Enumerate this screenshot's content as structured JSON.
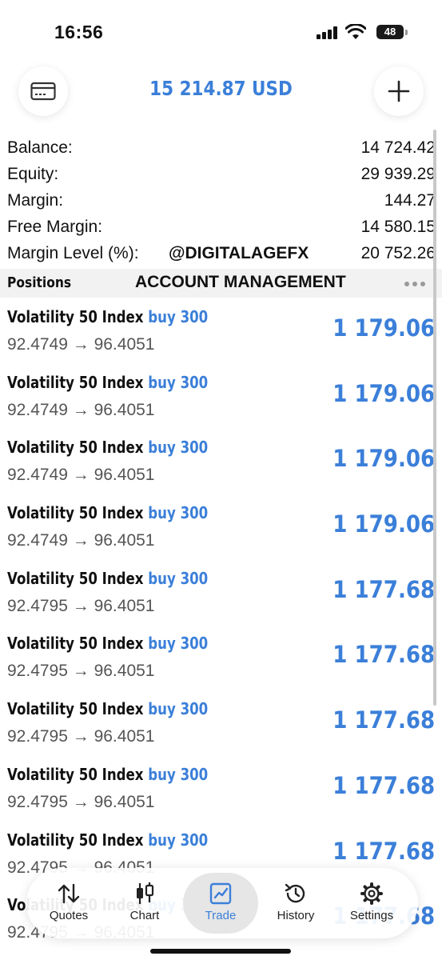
{
  "status": {
    "time": "16:56",
    "battery": "48"
  },
  "header": {
    "title": "15 214.87 USD"
  },
  "summary": [
    {
      "label": "Balance:",
      "value": "14 724.42"
    },
    {
      "label": "Equity:",
      "value": "29 939.29"
    },
    {
      "label": "Margin:",
      "value": "144.27"
    },
    {
      "label": "Free Margin:",
      "value": "14 580.15"
    },
    {
      "label": "Margin Level (%):",
      "value": "20 752.26"
    }
  ],
  "watermark": "@DIGITALAGEFX",
  "positions": {
    "title": "Positions",
    "banner": "ACCOUNT MANAGEMENT",
    "rows": [
      {
        "symbol": "Volatility 50 Index",
        "side": "buy 300",
        "prices": "92.4749 → 96.4051",
        "profit": "1 179.06"
      },
      {
        "symbol": "Volatility 50 Index",
        "side": "buy 300",
        "prices": "92.4749 → 96.4051",
        "profit": "1 179.06"
      },
      {
        "symbol": "Volatility 50 Index",
        "side": "buy 300",
        "prices": "92.4749 → 96.4051",
        "profit": "1 179.06"
      },
      {
        "symbol": "Volatility 50 Index",
        "side": "buy 300",
        "prices": "92.4749 → 96.4051",
        "profit": "1 179.06"
      },
      {
        "symbol": "Volatility 50 Index",
        "side": "buy 300",
        "prices": "92.4795 → 96.4051",
        "profit": "1 177.68"
      },
      {
        "symbol": "Volatility 50 Index",
        "side": "buy 300",
        "prices": "92.4795 → 96.4051",
        "profit": "1 177.68"
      },
      {
        "symbol": "Volatility 50 Index",
        "side": "buy 300",
        "prices": "92.4795 → 96.4051",
        "profit": "1 177.68"
      },
      {
        "symbol": "Volatility 50 Index",
        "side": "buy 300",
        "prices": "92.4795 → 96.4051",
        "profit": "1 177.68"
      },
      {
        "symbol": "Volatility 50 Index",
        "side": "buy 300",
        "prices": "92.4795 → 96.4051",
        "profit": "1 177.68"
      },
      {
        "symbol": "Volatility 50 Index",
        "side": "buy 300",
        "prices": "92.4795 → 96.4051",
        "profit": "1 177.68"
      }
    ]
  },
  "tabs": [
    {
      "label": "Quotes",
      "icon": "sort-arrows-icon"
    },
    {
      "label": "Chart",
      "icon": "candlestick-icon"
    },
    {
      "label": "Trade",
      "icon": "trend-chart-icon",
      "active": true
    },
    {
      "label": "History",
      "icon": "history-icon"
    },
    {
      "label": "Settings",
      "icon": "gear-icon"
    }
  ],
  "colors": {
    "accent": "#3b7fd9",
    "text": "#111111",
    "secondary_text": "#555555"
  }
}
